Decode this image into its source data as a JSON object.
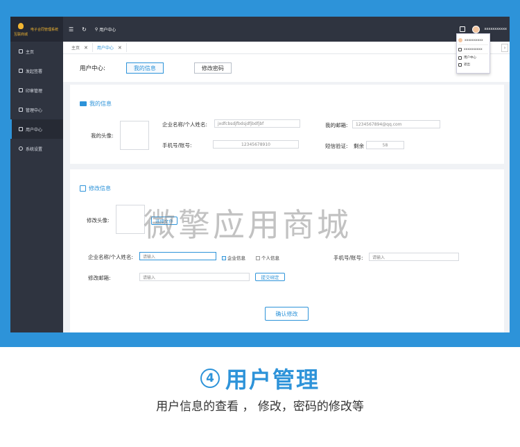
{
  "app": {
    "logo_text": "互联商城",
    "title": "电子合同管理系统"
  },
  "sidebar": {
    "items": [
      {
        "label": "主页",
        "icon": "home-icon"
      },
      {
        "label": "发起签署",
        "icon": "sign-icon"
      },
      {
        "label": "印章管理",
        "icon": "seal-icon"
      },
      {
        "label": "管理中心",
        "icon": "grid-icon"
      },
      {
        "label": "用户中心",
        "icon": "user-icon",
        "active": true
      },
      {
        "label": "系统设置",
        "icon": "gear-icon"
      }
    ]
  },
  "topbar": {
    "crumb": "用户中心",
    "username": "xxxxxxxxxxx"
  },
  "user_menu": {
    "items": [
      "xxxxxxxxxx",
      "xxxxxxxxxx",
      "用户中心",
      "退出"
    ]
  },
  "tabs": [
    {
      "label": "主页"
    },
    {
      "label": "用户中心",
      "active": true
    }
  ],
  "subhead": {
    "title": "用户中心:",
    "tab_info": "我的信息",
    "tab_password": "修改密码"
  },
  "my_info": {
    "title": "我的信息",
    "avatar_label": "我的头像:",
    "name_label": "企业名称/个人姓名:",
    "name_value": "jxdfcbsdjfbdsjdfjbdfjbf",
    "phone_label": "手机号/账号:",
    "phone_value": "12345678910",
    "email_label": "我的邮箱:",
    "email_value": "1234567894@qq.com",
    "sms_label": "短信验证:",
    "sms_remaining_label": "剩余",
    "sms_remaining_value": "58"
  },
  "edit_info": {
    "title": "修改信息",
    "avatar_label": "修改头像:",
    "choose_file": "选择文件",
    "name_label": "企业名称/个人姓名:",
    "name_placeholder": "请输入",
    "opt_company": "企业信息",
    "opt_personal": "个人信息",
    "phone_label": "手机号/账号:",
    "phone_placeholder": "请输入",
    "email_label": "修改邮箱:",
    "email_placeholder": "请输入",
    "submit_bind": "提交绑定",
    "confirm": "确认修改"
  },
  "watermark": "微擎应用商城",
  "caption": {
    "number": "4",
    "title": "用户管理",
    "subtitle": "用户信息的查看 ， 修改，密码的修改等"
  },
  "colors": {
    "accent": "#2d93d9",
    "sidebar": "#2f3440"
  }
}
